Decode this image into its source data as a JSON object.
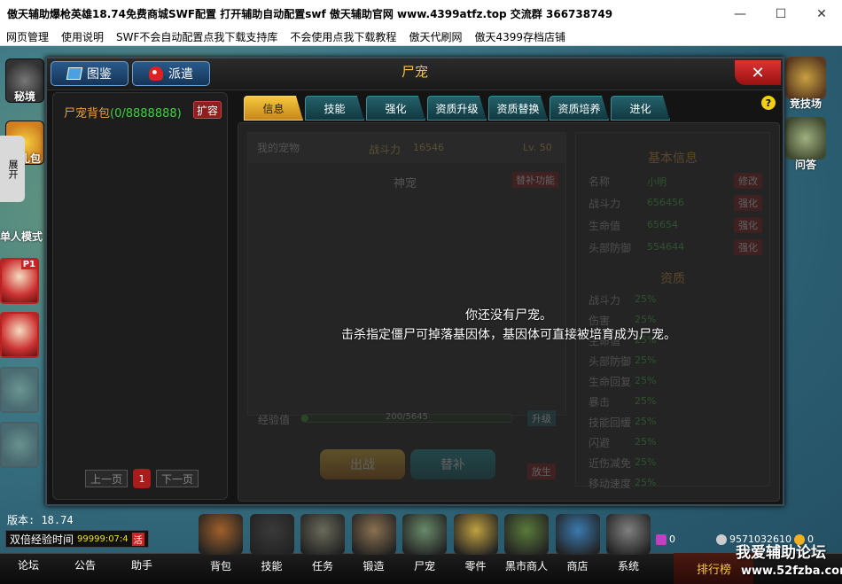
{
  "window": {
    "title": "傲天辅助爆枪英雄18.74免费商城SWF配置  打开辅助自动配置swf 傲天辅助官网 www.4399atfz.top 交流群 366738749",
    "controls": [
      "—",
      "☐",
      "✕"
    ]
  },
  "menu": [
    "网页管理",
    "使用说明",
    "SWF不会自动配置点我下载支持库",
    "不会使用点我下载教程",
    "傲天代刷网",
    "傲天4399存档店铺"
  ],
  "left_side": {
    "top_icon_label": "秘境",
    "gift_label": "超礼包",
    "expand_label": "展开",
    "mode_label": "单人模式",
    "p1_badge": "P1"
  },
  "right_side": {
    "arena_label": "竞技场",
    "qa_label": "问答"
  },
  "dialog": {
    "title": "尸宠",
    "btn_atlas": "图鉴",
    "btn_dispatch": "派遣",
    "close": "✕",
    "help": "?",
    "bag_title": "尸宠背包",
    "bag_count": "(0/8888888)",
    "expand_btn": "扩容",
    "prev": "上一页",
    "next": "下一页",
    "page": "1",
    "tabs": [
      "信息",
      "技能",
      "强化",
      "资质升级",
      "资质替换",
      "资质培养",
      "进化"
    ],
    "active_tab": "信息",
    "my_pet": "我的宠物",
    "power_label": "战斗力",
    "power_value": "16546",
    "level": "Lv. 50",
    "pet_name": "神宠",
    "swap_func": "替补功能",
    "xp_label": "经验值",
    "xp_text": "200/5645",
    "xp_fraction": 0.035,
    "upgrade": "升级",
    "btn_fight": "出战",
    "btn_sub": "替补",
    "btn_release": "放生",
    "basic_info_title": "基本信息",
    "basic_info": [
      {
        "label": "名称",
        "value": "小明",
        "action": "修改"
      },
      {
        "label": "战斗力",
        "value": "656456",
        "action": "强化"
      },
      {
        "label": "生命值",
        "value": "65654",
        "action": "强化"
      },
      {
        "label": "头部防御",
        "value": "554644",
        "action": "强化"
      }
    ],
    "aptitude_title": "资质",
    "aptitudes": [
      {
        "label": "战斗力",
        "value": "25%"
      },
      {
        "label": "伤害",
        "value": "25%"
      },
      {
        "label": "生命值",
        "value": "25%"
      },
      {
        "label": "头部防御",
        "value": "25%"
      },
      {
        "label": "生命回复",
        "value": "25%"
      },
      {
        "label": "暴击",
        "value": "25%"
      },
      {
        "label": "技能回缓",
        "value": "25%"
      },
      {
        "label": "闪避",
        "value": "25%"
      },
      {
        "label": "近伤减免",
        "value": "25%"
      },
      {
        "label": "移动速度",
        "value": "25%"
      }
    ],
    "empty_line1": "你还没有尸宠。",
    "empty_line2": "击杀指定僵尸可掉落基因体，基因体可直接被培育成为尸宠。"
  },
  "status": {
    "version": "版本: 18.74",
    "double_xp_label": "双倍经验时间",
    "double_xp_value": "99999:07:4",
    "double_xp_badge": "活"
  },
  "bottom_nav_left": [
    "论坛",
    "公告",
    "助手"
  ],
  "bottom_icons": [
    {
      "label": "背包",
      "icon": "backpack-icon",
      "color": "#a0602a"
    },
    {
      "label": "技能",
      "icon": "skill-icon",
      "color": "#3a3a3a"
    },
    {
      "label": "任务",
      "icon": "scroll-icon",
      "color": "#6a6a5a"
    },
    {
      "label": "锻造",
      "icon": "hammer-icon",
      "color": "#8a7050"
    },
    {
      "label": "尸宠",
      "icon": "zombie-pet-icon",
      "color": "#6a8a6a"
    },
    {
      "label": "零件",
      "icon": "bullets-icon",
      "color": "#c0a040"
    },
    {
      "label": "黑市商人",
      "icon": "merchant-icon",
      "color": "#5a7a3a"
    },
    {
      "label": "商店",
      "icon": "shop-icon",
      "color": "#3a7ab0"
    },
    {
      "label": "系统",
      "icon": "gear-icon",
      "color": "#808080"
    }
  ],
  "currency": {
    "c1": "0",
    "c2": "9571032610",
    "c3": "0"
  },
  "rank_label": "排行榜",
  "recharge_label": "充值",
  "watermark": "我爱辅助论坛",
  "watermark_url": "www.52fzba.com"
}
